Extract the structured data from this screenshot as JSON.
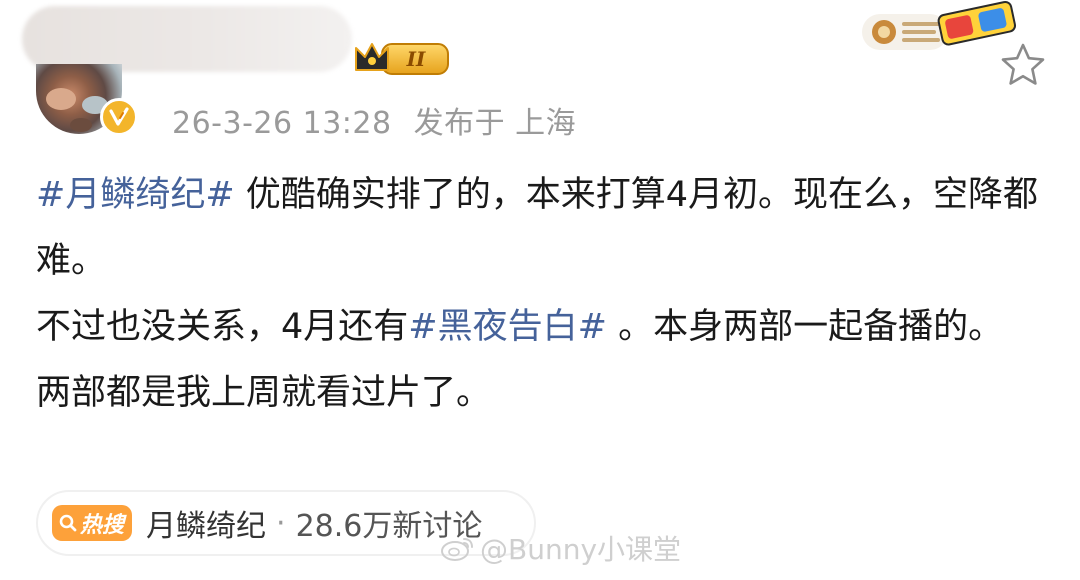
{
  "header": {
    "level_badge_text": "II",
    "timestamp": "26-3-26 13:28",
    "location_prefix": "发布于",
    "location": "上海"
  },
  "post": {
    "line1": {
      "topic": "#月鳞绮纪#",
      "text": " 优酷确实排了的，本来打算4月初。现在么，空降都难。"
    },
    "line2": {
      "text_before": "不过也没关系，4月还有",
      "topic": "#黑夜告白#",
      "text_after": " 。本身两部一起备播的。"
    },
    "line3": {
      "text": "两部都是我上周就看过片了。"
    }
  },
  "hot_search": {
    "tag": "热搜",
    "title": "月鳞绮纪",
    "separator": "·",
    "count": "28.6万新讨论"
  },
  "watermark": {
    "text": "@Bunny小课堂"
  },
  "colors": {
    "topic_link": "#45629a",
    "hot_tag_bg": "#fda13a",
    "timestamp": "#9a9a9a",
    "body_text": "#1a1a1a"
  },
  "icons": {
    "verified": "verified-v-icon",
    "crown": "crown-level-icon",
    "deco": "3d-glasses-decoration",
    "favorite": "star-outline-icon",
    "hot_search": "search-icon",
    "watermark": "weibo-logo-icon"
  }
}
